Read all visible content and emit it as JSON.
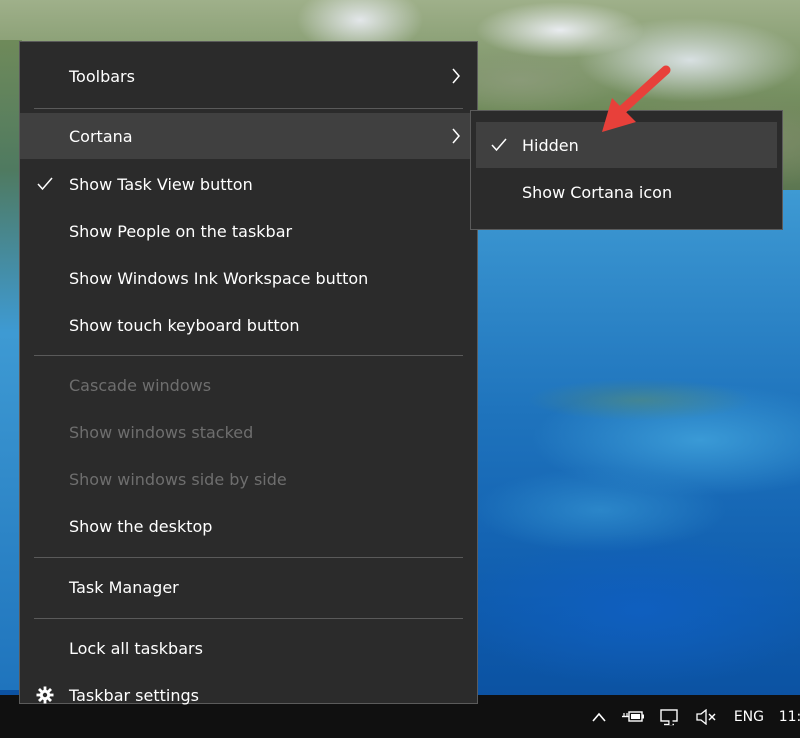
{
  "menu": {
    "items": [
      {
        "label": "Toolbars",
        "submenu": true
      },
      {
        "label": "Cortana",
        "submenu": true,
        "highlighted": true
      },
      {
        "label": "Show Task View button",
        "checked": true
      },
      {
        "label": "Show People on the taskbar"
      },
      {
        "label": "Show Windows Ink Workspace button"
      },
      {
        "label": "Show touch keyboard button"
      },
      {
        "label": "Cascade windows",
        "disabled": true
      },
      {
        "label": "Show windows stacked",
        "disabled": true
      },
      {
        "label": "Show windows side by side",
        "disabled": true
      },
      {
        "label": "Show the desktop"
      },
      {
        "label": "Task Manager"
      },
      {
        "label": "Lock all taskbars"
      },
      {
        "label": "Taskbar settings",
        "icon": "gear-icon"
      }
    ]
  },
  "submenu": {
    "items": [
      {
        "label": "Hidden",
        "checked": true,
        "highlighted": true
      },
      {
        "label": "Show Cortana icon"
      }
    ]
  },
  "taskbar": {
    "tray": {
      "icons": [
        "chevron-up-icon",
        "power-battery-icon",
        "network-icon",
        "volume-muted-icon"
      ],
      "language": "ENG",
      "clock": "11:"
    }
  },
  "colors": {
    "menu_bg": "#2b2b2b",
    "menu_highlight": "#404040",
    "menu_border": "#5b5b5b",
    "text": "#ffffff",
    "disabled_text": "#6e6e6e",
    "taskbar_bg": "#101010",
    "annotation_arrow": "#e8403a"
  }
}
